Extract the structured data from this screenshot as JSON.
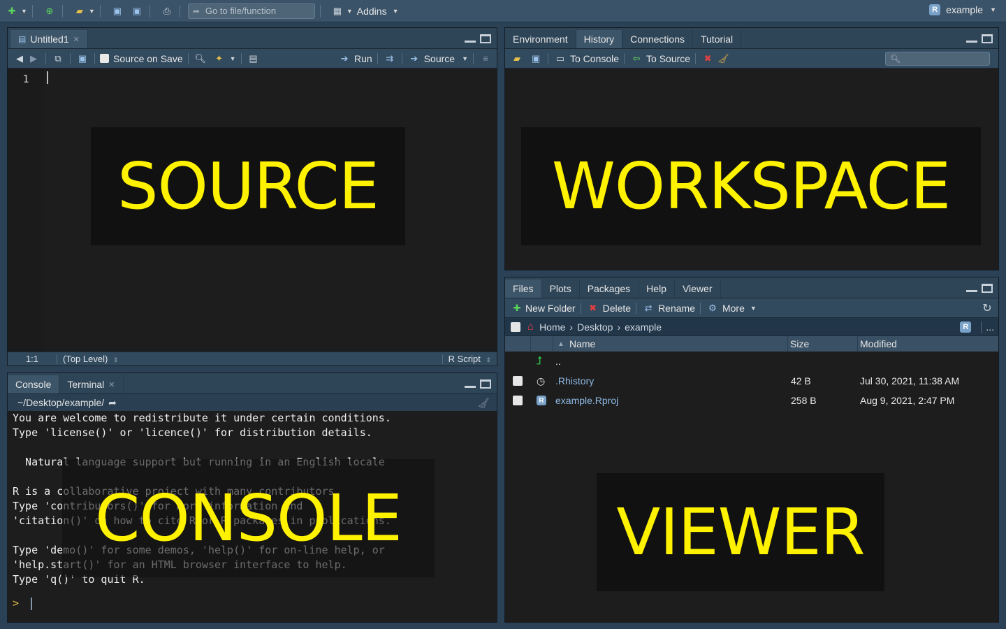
{
  "topbar": {
    "goto_placeholder": "Go to file/function",
    "addins": "Addins",
    "project": "example"
  },
  "source_pane": {
    "tab": "Untitled1",
    "toolbar": {
      "source_on_save": "Source on Save",
      "run": "Run",
      "source": "Source"
    },
    "line_number": "1",
    "overlay_label": "SOURCE",
    "status": {
      "position": "1:1",
      "scope": "(Top Level)",
      "file_type": "R Script"
    }
  },
  "workspace_pane": {
    "tabs": [
      "Environment",
      "History",
      "Connections",
      "Tutorial"
    ],
    "active_tab": "History",
    "toolbar": {
      "to_console": "To Console",
      "to_source": "To Source"
    },
    "overlay_label": "WORKSPACE"
  },
  "console_pane": {
    "tabs": [
      "Console",
      "Terminal"
    ],
    "path": "~/Desktop/example/",
    "lines": [
      "You are welcome to redistribute it under certain conditions.",
      "Type 'license()' or 'licence()' for distribution details.",
      "",
      "  Natural language support but running in an English locale",
      "",
      "R is a collaborative project with many contributors.",
      "Type 'contributors()' for more information and",
      "'citation()' on how to cite R or R packages in publications.",
      "",
      "Type 'demo()' for some demos, 'help()' for on-line help, or",
      "'help.start()' for an HTML browser interface to help.",
      "Type 'q()' to quit R."
    ],
    "prompt": ">",
    "overlay_label": "CONSOLE"
  },
  "files_pane": {
    "tabs": [
      "Files",
      "Plots",
      "Packages",
      "Help",
      "Viewer"
    ],
    "toolbar": {
      "new_folder": "New Folder",
      "delete": "Delete",
      "rename": "Rename",
      "more": "More"
    },
    "breadcrumb": [
      "Home",
      "Desktop",
      "example"
    ],
    "more_dots": "...",
    "columns": {
      "name": "Name",
      "size": "Size",
      "modified": "Modified"
    },
    "parent_dir": "..",
    "files": [
      {
        "name": ".Rhistory",
        "size": "42 B",
        "modified": "Jul 30, 2021, 11:38 AM"
      },
      {
        "name": "example.Rproj",
        "size": "258 B",
        "modified": "Aug 9, 2021, 2:47 PM"
      }
    ],
    "overlay_label": "VIEWER"
  }
}
